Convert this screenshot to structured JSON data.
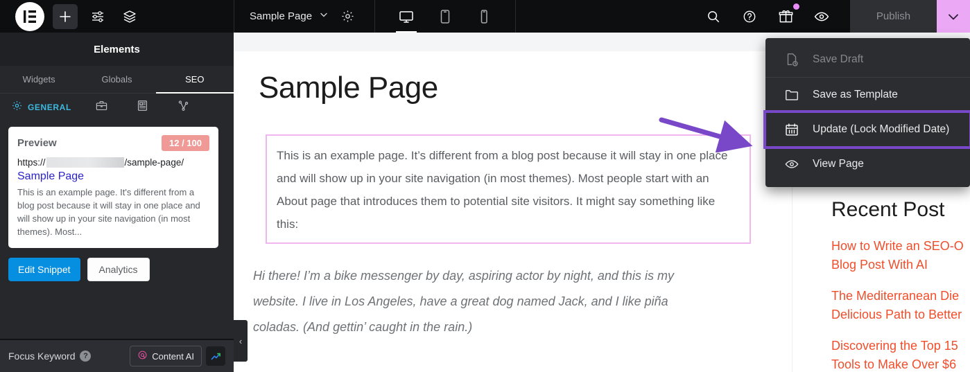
{
  "topbar": {
    "logo_name": "elementor-logo",
    "add_label": "+",
    "page_name": "Sample Page",
    "devices": [
      {
        "name": "desktop",
        "active": true
      },
      {
        "name": "tablet",
        "active": false
      },
      {
        "name": "mobile",
        "active": false
      }
    ],
    "publish_label": "Publish",
    "accent_pink": "#eba8f5",
    "gift_badge_color": "#e98cf5"
  },
  "dropdown": {
    "items": [
      {
        "label": "Save Draft",
        "icon": "save-draft-icon",
        "disabled": true,
        "highlight": false
      },
      {
        "label": "Save as Template",
        "icon": "folder-icon",
        "disabled": false,
        "highlight": false
      },
      {
        "label": "Update (Lock Modified Date)",
        "icon": "calendar-icon",
        "disabled": false,
        "highlight": true
      },
      {
        "label": "View Page",
        "icon": "eye-icon",
        "disabled": false,
        "highlight": false
      }
    ],
    "highlight_color": "#7848c8"
  },
  "sidebar": {
    "header": "Elements",
    "tabs": [
      {
        "label": "Widgets",
        "active": false
      },
      {
        "label": "Globals",
        "active": false
      },
      {
        "label": "SEO",
        "active": true
      }
    ],
    "subtabs": [
      {
        "label": "GENERAL",
        "icon": "gear-icon",
        "active": true
      },
      {
        "label": "",
        "icon": "briefcase-icon",
        "active": false
      },
      {
        "label": "",
        "icon": "schema-article-icon",
        "active": false
      },
      {
        "label": "",
        "icon": "social-share-icon",
        "active": false
      }
    ],
    "preview": {
      "title": "Preview",
      "score": "12 / 100",
      "score_color": "#ef9a96",
      "url_prefix": "https://",
      "url_suffix": "/sample-page/",
      "link_title": "Sample Page",
      "description": "This is an example page. It's different from a blog post because it will stay in one place and will show up in your site navigation (in most themes). Most..."
    },
    "buttons": {
      "edit_snippet": "Edit Snippet",
      "analytics": "Analytics"
    },
    "footer": {
      "focus_keyword_label": "Focus Keyword",
      "help_glyph": "?",
      "content_ai_label": "Content AI"
    },
    "collapse_glyph": "‹"
  },
  "canvas": {
    "page_title": "Sample Page",
    "paragraph": "This is an example page. It’s different from a blog post because it will stay in one place and will show up in your site navigation (in most themes). Most people start with an About page that introduces them to potential site visitors. It might say something like this:",
    "quote": "Hi there! I’m a bike messenger by day, aspiring actor by night, and this is my website. I live in Los Angeles, have a great dog named Jack, and I like piña coladas. (And gettin’ caught in the rain.)",
    "selection_border_color": "#f1b6ef",
    "rail": {
      "title": "Recent Post",
      "links": [
        "How to Write an SEO-O",
        "Blog Post With AI",
        "The Mediterranean Die",
        "Delicious Path to Better",
        "Discovering the Top 15",
        "Tools to Make Over $6"
      ],
      "link_color": "#f04e2b"
    }
  },
  "annotation": {
    "arrow_name": "purple-arrow-annotation",
    "arrow_color": "#7848c8"
  }
}
